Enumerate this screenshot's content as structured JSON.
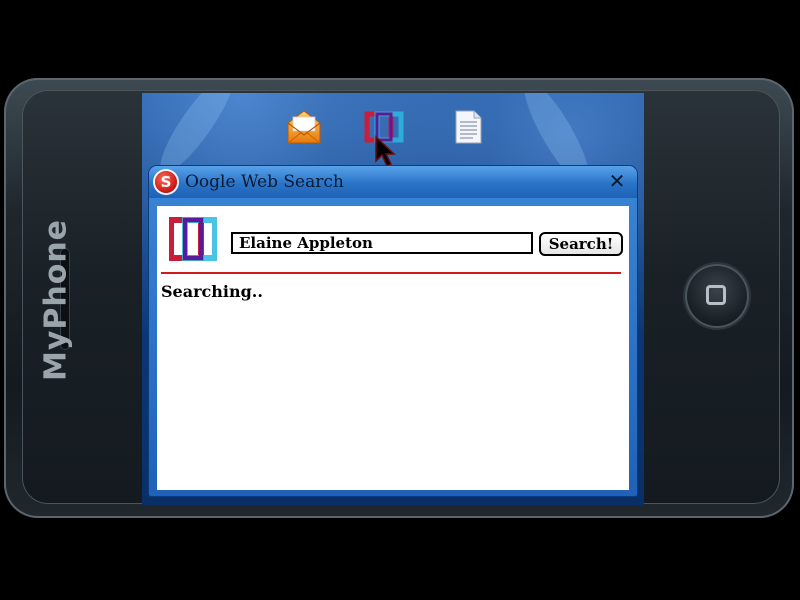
{
  "device": {
    "brand": "MyPhone"
  },
  "desktop": {
    "icons": [
      {
        "name": "mail-icon"
      },
      {
        "name": "oogle-search-icon"
      },
      {
        "name": "document-icon"
      }
    ]
  },
  "window": {
    "title": "Oogle Web Search",
    "close_label": "✕",
    "app_logo_letter": "S"
  },
  "search": {
    "input_value": "Elaine Appleton",
    "button_label": "Search!",
    "status": "Searching.."
  },
  "colors": {
    "divider": "#d2191f",
    "logo_red": "#c81e3c",
    "logo_cyan": "#2ab8e0",
    "logo_purple": "#5a1a9a"
  }
}
